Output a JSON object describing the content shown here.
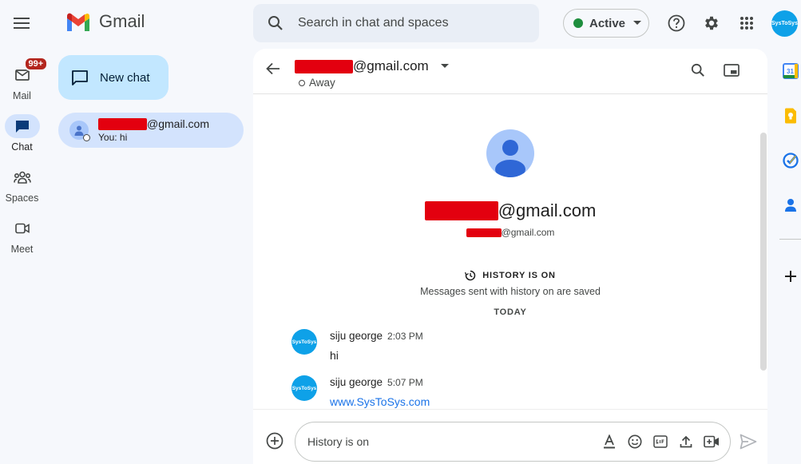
{
  "header": {
    "app_name": "Gmail",
    "search_placeholder": "Search in chat and spaces",
    "status_label": "Active",
    "avatar_text": "SysToSys"
  },
  "rail": {
    "items": [
      {
        "label": "Mail",
        "badge": "99+"
      },
      {
        "label": "Chat"
      },
      {
        "label": "Spaces"
      },
      {
        "label": "Meet"
      }
    ]
  },
  "chat_list": {
    "new_chat_label": "New chat",
    "items": [
      {
        "email_suffix": "@gmail.com",
        "preview": "You: hi"
      }
    ]
  },
  "conversation": {
    "title_suffix": "@gmail.com",
    "status": "Away",
    "contact_name_suffix": "@gmail.com",
    "contact_email_suffix": "@gmail.com",
    "history_title": "HISTORY IS ON",
    "history_subtitle": "Messages sent with history on are saved",
    "day_divider": "TODAY",
    "messages": [
      {
        "sender": "siju george",
        "time": "2:03 PM",
        "text": "hi",
        "avatar_text": "SysToSys"
      },
      {
        "sender": "siju george",
        "time": "5:07 PM",
        "text": "www.SysToSys.com",
        "avatar_text": "SysToSys"
      }
    ],
    "composer_placeholder": "History is on"
  },
  "colors": {
    "accent": "#0b57d0",
    "active_green": "#1e8e3e",
    "redaction": "#e3000f",
    "link": "#1a73e8"
  }
}
